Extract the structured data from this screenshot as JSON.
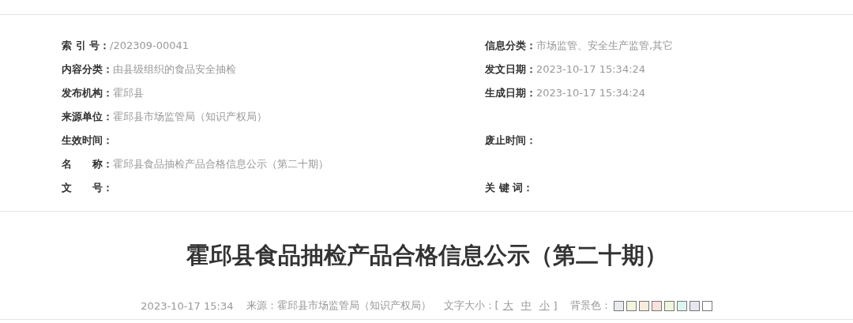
{
  "info_rows": [
    {
      "left": {
        "label": "索 引 号：",
        "value": "/202309-00041"
      },
      "right": {
        "label": "信息分类：",
        "value": "市场监管、安全生产监管,其它"
      }
    },
    {
      "left": {
        "label": "内容分类：",
        "value": "由县级组织的食品安全抽检"
      },
      "right": {
        "label": "发文日期：",
        "value": "2023-10-17 15:34:24"
      }
    },
    {
      "left": {
        "label": "发布机构：",
        "value": "霍邱县"
      },
      "right": {
        "label": "生成日期：",
        "value": "2023-10-17 15:34:24"
      }
    },
    {
      "left": {
        "label": "来源单位：",
        "value": "霍邱县市场监管局（知识产权局）"
      }
    },
    {
      "left": {
        "label": "生效时间："
      },
      "right": {
        "label": "废止时间："
      }
    },
    {
      "left": {
        "label": "名　　称：",
        "value": "霍邱县食品抽检产品合格信息公示（第二十期）"
      }
    },
    {
      "left": {
        "label": "文　　号："
      },
      "right": {
        "label": "关 键 词："
      }
    }
  ],
  "article": {
    "title": "霍邱县食品抽检产品合格信息公示（第二十期）",
    "date": "2023-10-17 15:34",
    "source": "来源：霍邱县市场监管局（知识产权局）",
    "font_size_label": "文字大小：[",
    "font_sizes": [
      "大",
      "中",
      "小"
    ],
    "font_size_close": "]",
    "background_label": "背景色：",
    "background_colors": [
      {
        "color": "#e9ebf0"
      },
      {
        "color": "#f3f5dc"
      },
      {
        "color": "#f8ecdc"
      },
      {
        "color": "#fbe1dc"
      },
      {
        "color": "#eef6dc"
      },
      {
        "color": "#dcf5ef"
      },
      {
        "color": "#e5e6ee"
      },
      {
        "color": "#ffffff"
      }
    ]
  }
}
